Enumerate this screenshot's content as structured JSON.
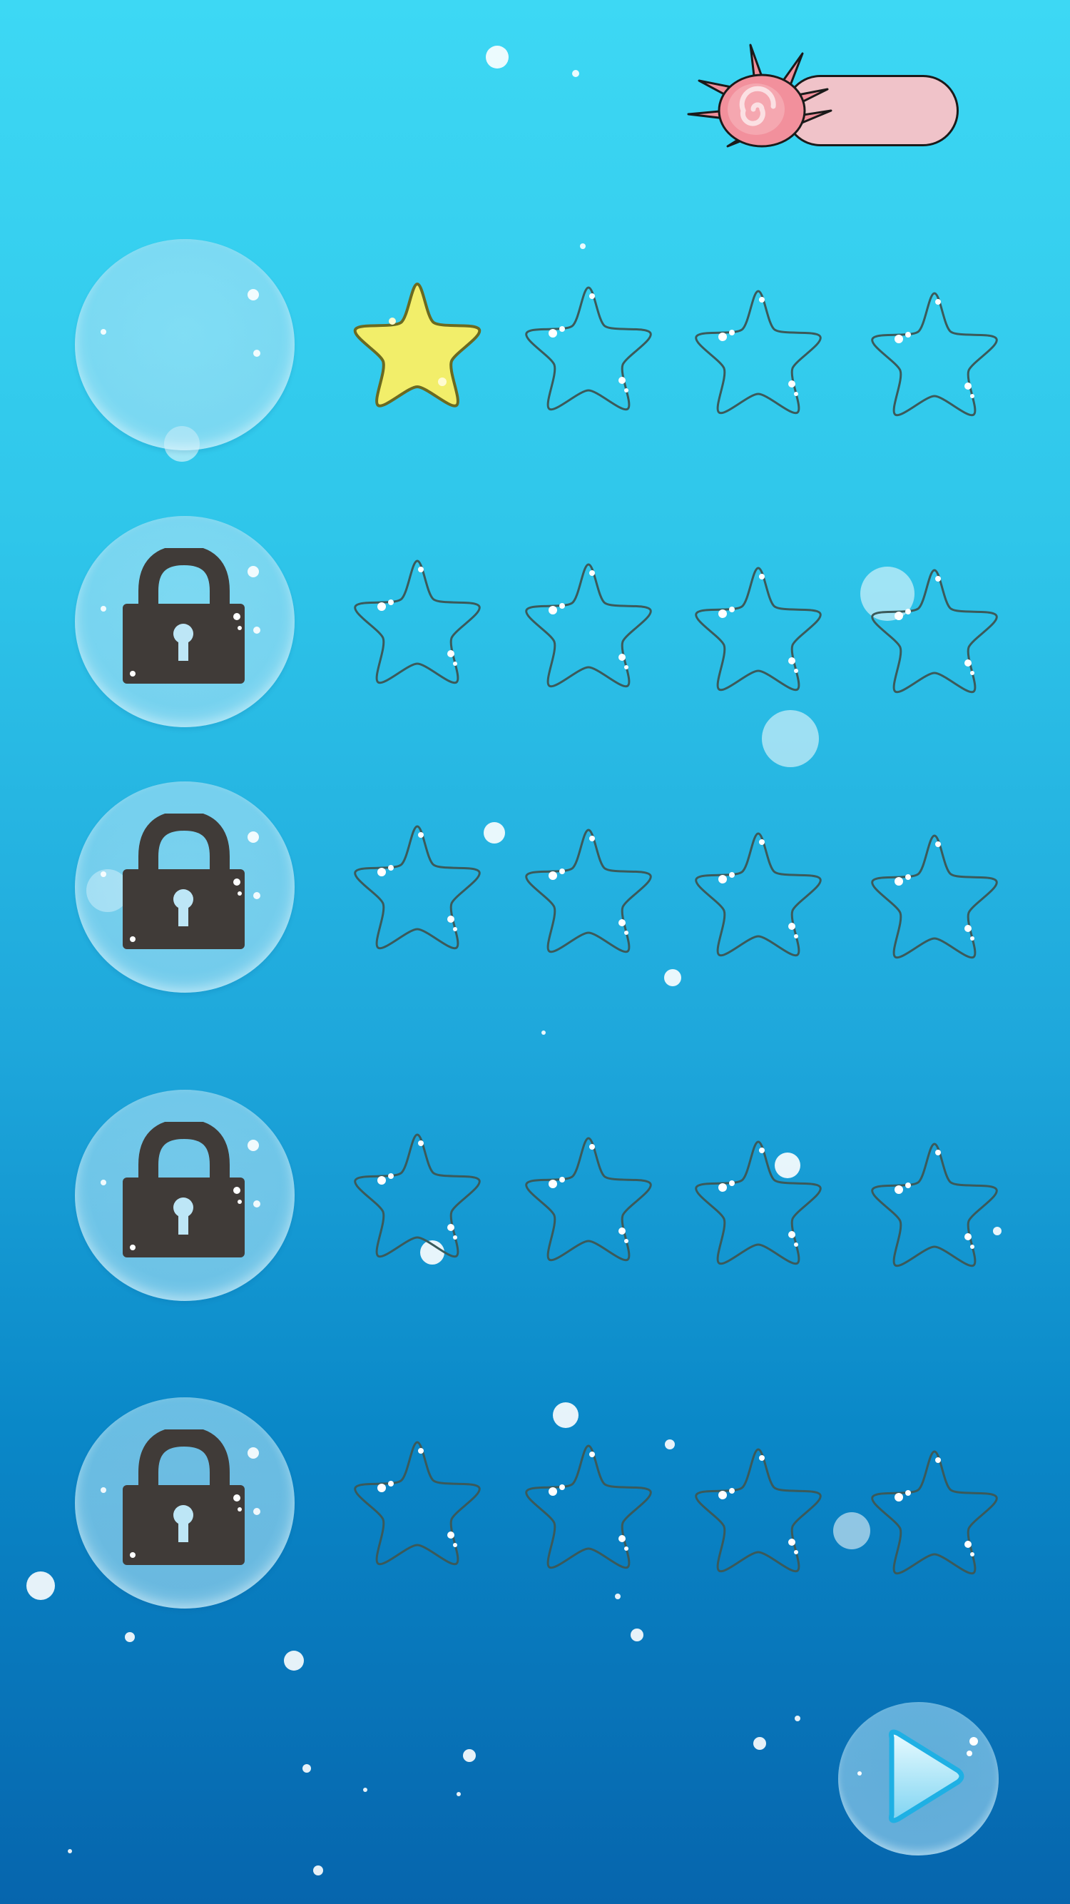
{
  "screen": "level-select",
  "colors": {
    "background_top": "#3dd8f4",
    "background_bottom": "#0665ad",
    "star_earned": "#f2ee6a",
    "star_empty_outline": "#3b5a5a",
    "lock_body": "#403b38",
    "shell": "#f2909c",
    "progress_pill": "#f0c3c9"
  },
  "top_bar": {
    "shell_icon": "sea-urchin-shell-icon",
    "progress_fraction": 0
  },
  "levels": [
    {
      "index": 1,
      "locked": false,
      "stars_earned": 1,
      "stars_total": 4
    },
    {
      "index": 2,
      "locked": true,
      "stars_earned": 0,
      "stars_total": 4
    },
    {
      "index": 3,
      "locked": true,
      "stars_earned": 0,
      "stars_total": 4
    },
    {
      "index": 4,
      "locked": true,
      "stars_earned": 0,
      "stars_total": 4
    },
    {
      "index": 5,
      "locked": true,
      "stars_earned": 0,
      "stars_total": 4
    }
  ],
  "icons": {
    "lock": "padlock-icon",
    "star": "starfish-star-icon",
    "play": "play-triangle-icon"
  }
}
